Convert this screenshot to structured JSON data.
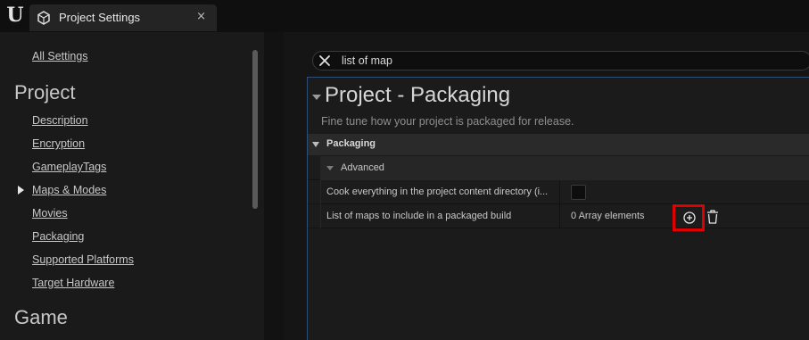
{
  "window": {
    "tab_title": "Project Settings",
    "tab_close": "×"
  },
  "sidebar": {
    "all_settings": "All Settings",
    "sections": [
      {
        "title": "Project",
        "items": [
          {
            "label": "Description"
          },
          {
            "label": "Encryption"
          },
          {
            "label": "GameplayTags"
          },
          {
            "label": "Maps & Modes"
          },
          {
            "label": "Movies"
          },
          {
            "label": "Packaging"
          },
          {
            "label": "Supported Platforms"
          },
          {
            "label": "Target Hardware"
          }
        ]
      },
      {
        "title": "Game",
        "items": []
      }
    ]
  },
  "search": {
    "value": "list of map"
  },
  "panel": {
    "title": "Project - Packaging",
    "description": "Fine tune how your project is packaged for release.",
    "category": "Packaging",
    "subcategory": "Advanced",
    "properties": [
      {
        "name": "Cook everything in the project content directory (i...",
        "value": ""
      },
      {
        "name": "List of maps to include in a packaged build",
        "value": "0 Array elements"
      }
    ]
  },
  "colors": {
    "highlight_box": "#e00000",
    "panel_border": "#2f4f78"
  }
}
